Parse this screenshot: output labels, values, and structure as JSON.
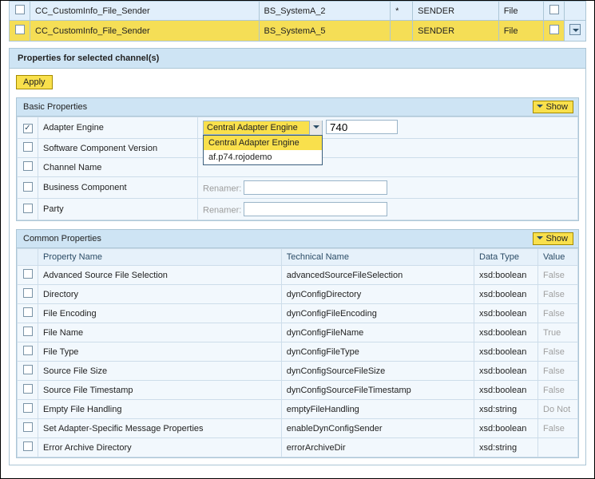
{
  "channels": [
    {
      "name": "CC_CustomInfo_File_Sender",
      "system": "BS_SystemA_2",
      "flag": "*",
      "dir": "SENDER",
      "adapter": "File",
      "checked": false
    },
    {
      "name": "CC_CustomInfo_File_Sender",
      "system": "BS_SystemA_5",
      "flag": "",
      "dir": "SENDER",
      "adapter": "File",
      "checked": false
    }
  ],
  "panel_title": "Properties for selected channel(s)",
  "apply_label": "Apply",
  "basic": {
    "heading": "Basic Properties",
    "show_label": "Show",
    "rows": {
      "adapter_engine": {
        "label": "Adapter Engine",
        "checked": true,
        "value": "Central Adapter Engine",
        "aux": "740",
        "options": [
          "Central Adapter Engine",
          "af.p74.rojodemo"
        ]
      },
      "scv": {
        "label": "Software Component Version",
        "checked": false
      },
      "channel_name": {
        "label": "Channel Name",
        "checked": false
      },
      "business_component": {
        "label": "Business Component",
        "checked": false,
        "renamer": "Renamer:"
      },
      "party": {
        "label": "Party",
        "checked": false,
        "renamer": "Renamer:"
      }
    }
  },
  "common": {
    "heading": "Common Properties",
    "show_label": "Show",
    "columns": {
      "prop": "Property Name",
      "tech": "Technical Name",
      "dtype": "Data Type",
      "val": "Value"
    },
    "rows": [
      {
        "prop": "Advanced Source File Selection",
        "tech": "advancedSourceFileSelection",
        "dtype": "xsd:boolean",
        "val": "False"
      },
      {
        "prop": "Directory",
        "tech": "dynConfigDirectory",
        "dtype": "xsd:boolean",
        "val": "False"
      },
      {
        "prop": "File Encoding",
        "tech": "dynConfigFileEncoding",
        "dtype": "xsd:boolean",
        "val": "False"
      },
      {
        "prop": "File Name",
        "tech": "dynConfigFileName",
        "dtype": "xsd:boolean",
        "val": "True"
      },
      {
        "prop": "File Type",
        "tech": "dynConfigFileType",
        "dtype": "xsd:boolean",
        "val": "False"
      },
      {
        "prop": "Source File Size",
        "tech": "dynConfigSourceFileSize",
        "dtype": "xsd:boolean",
        "val": "False"
      },
      {
        "prop": "Source File Timestamp",
        "tech": "dynConfigSourceFileTimestamp",
        "dtype": "xsd:boolean",
        "val": "False"
      },
      {
        "prop": "Empty File Handling",
        "tech": "emptyFileHandling",
        "dtype": "xsd:string",
        "val": "Do Not"
      },
      {
        "prop": "Set Adapter-Specific Message Properties",
        "tech": "enableDynConfigSender",
        "dtype": "xsd:boolean",
        "val": "False"
      },
      {
        "prop": "Error Archive Directory",
        "tech": "errorArchiveDir",
        "dtype": "xsd:string",
        "val": ""
      }
    ]
  }
}
